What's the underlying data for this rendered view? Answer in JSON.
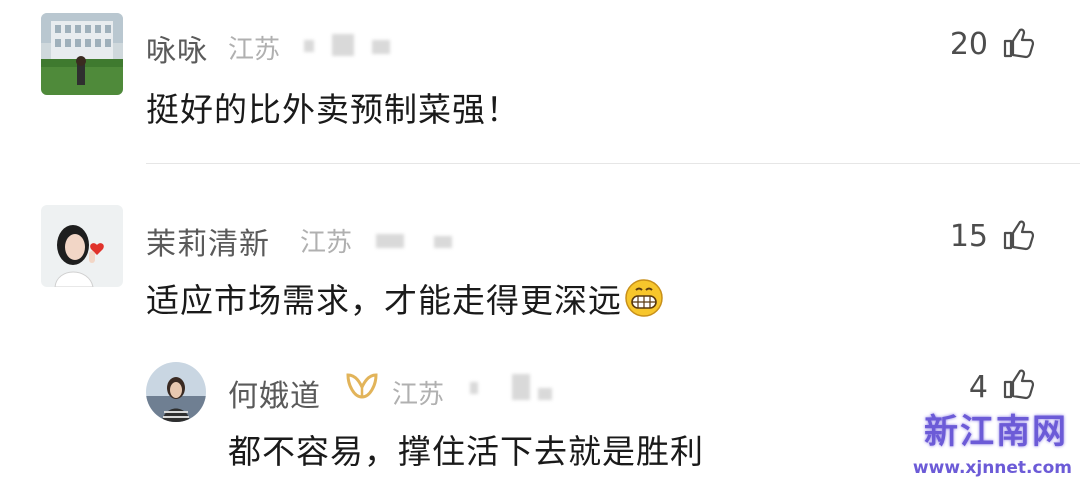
{
  "comments": [
    {
      "user": "咏咏",
      "location": "江苏",
      "likes": "20",
      "text": "挺好的比外卖预制菜强！",
      "avatar_icon": "building-lawn-photo-avatar"
    },
    {
      "user": "茉莉清新",
      "location": "江苏",
      "likes": "15",
      "text": "适应市场需求，才能走得更深远",
      "emoji": "grinning-face",
      "avatar_icon": "girl-with-heart-avatar",
      "replies": [
        {
          "user": "何娥道",
          "location": "江苏",
          "likes": "4",
          "text": "都不容易，撑住活下去就是胜利",
          "badge_icon": "gold-ribbon-badge",
          "avatar_icon": "seaside-photo-avatar"
        }
      ]
    }
  ],
  "watermark": {
    "title": "新江南网",
    "url": "www.xjnnet.com"
  },
  "colors": {
    "name": "#5a5a5a",
    "location": "#b0b0b0",
    "text": "#1a1a1a",
    "watermark": "#6c5bd7"
  }
}
